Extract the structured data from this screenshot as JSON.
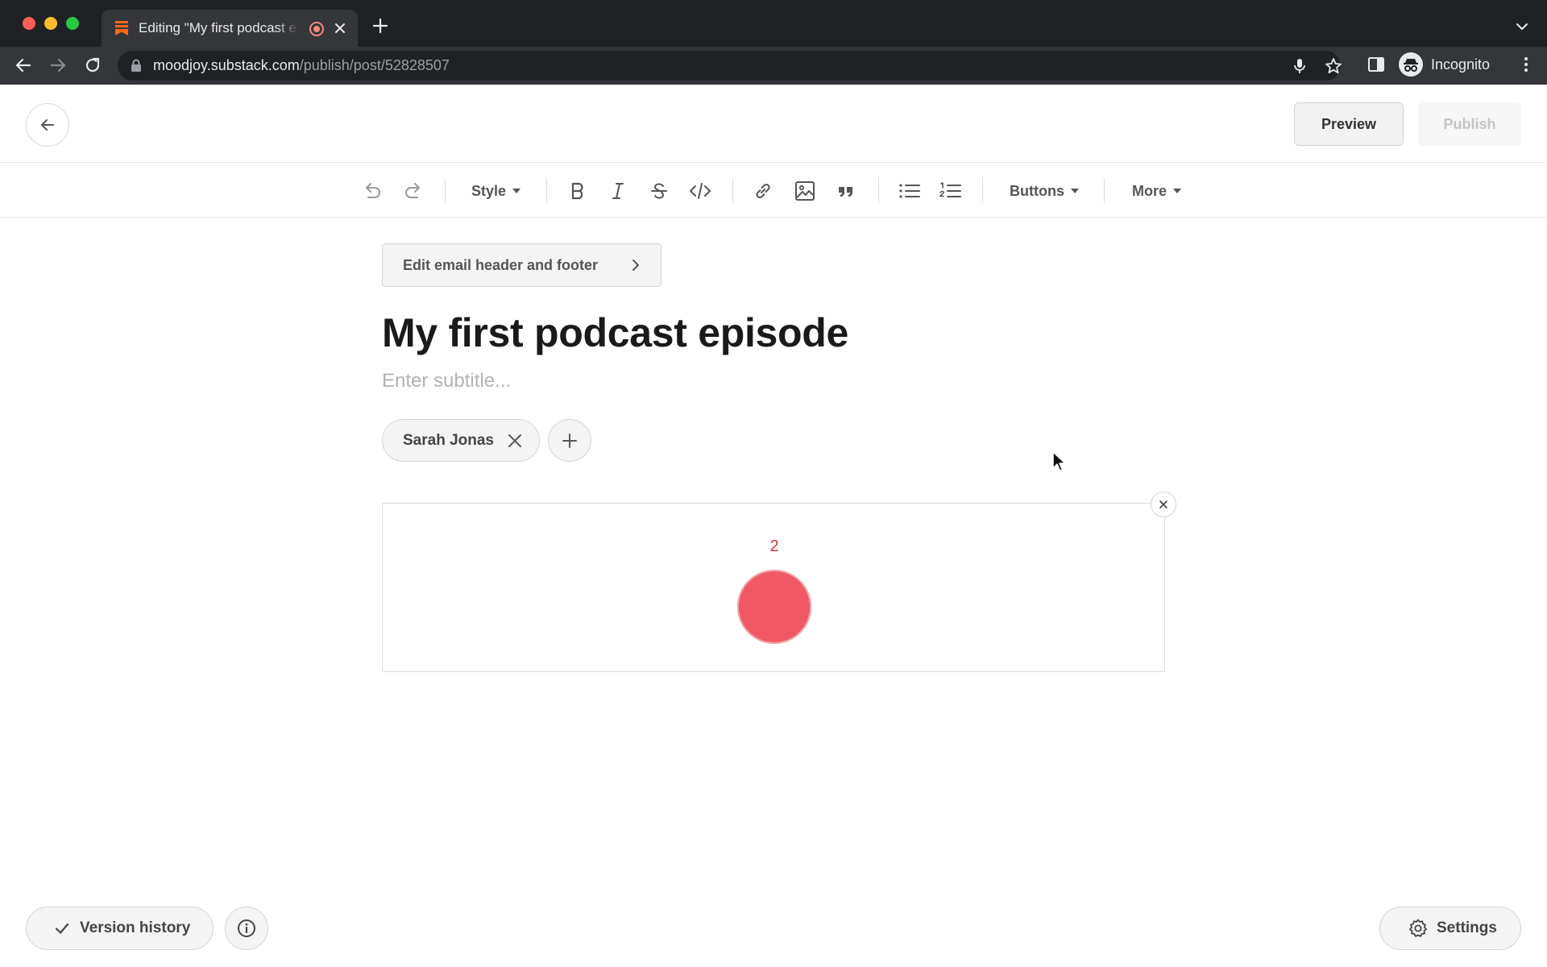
{
  "browser": {
    "tab_title": "Editing \"My first podcast e",
    "url_host": "moodjoy.substack.com",
    "url_path": "/publish/post/52828507",
    "profile_label": "Incognito",
    "icons": [
      "back-icon",
      "forward-icon",
      "reload-icon",
      "lock-icon",
      "microphone-icon",
      "star-icon",
      "side-panel-icon",
      "incognito-icon",
      "menu-icon",
      "new-tab-icon",
      "tab-search-icon"
    ]
  },
  "editor": {
    "preview_label": "Preview",
    "publish_label": "Publish",
    "toolbar": {
      "style_label": "Style",
      "buttons_label": "Buttons",
      "more_label": "More"
    },
    "edit_email_label": "Edit email header and footer",
    "title": "My first podcast episode",
    "subtitle_placeholder": "Enter subtitle...",
    "byline_author": "Sarah Jonas",
    "podcast_recorder": {
      "countdown": "2"
    },
    "version_history_label": "Version history",
    "settings_label": "Settings"
  },
  "colors": {
    "record_red": "#f05865",
    "countdown_red": "#e0303f",
    "substack_orange": "#ff6719",
    "browser_dark": "#202124"
  }
}
